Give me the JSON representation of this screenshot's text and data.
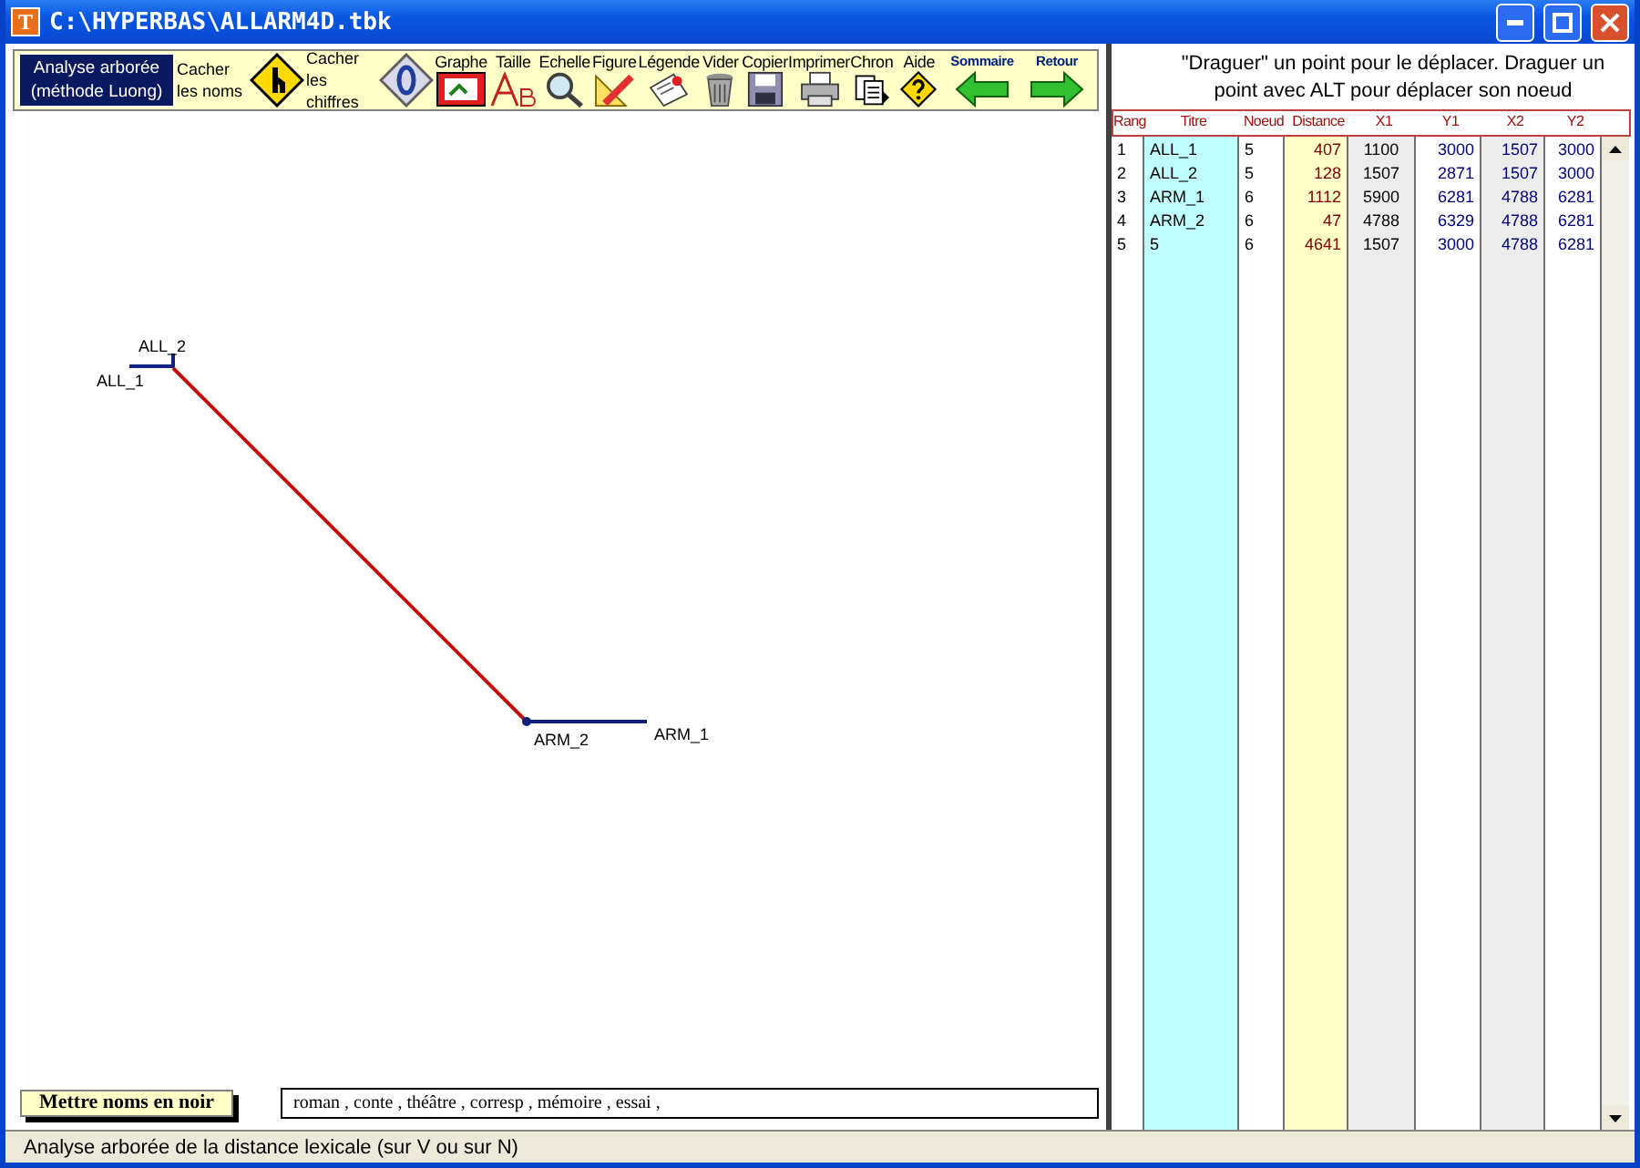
{
  "window": {
    "title": "C:\\HYPERBAS\\ALLARM4D.tbk",
    "app_icon": "T"
  },
  "toolbar": {
    "mode_button": "Analyse arborée (méthode Luong)",
    "items": [
      {
        "label": "Cacher les noms",
        "kind": "side"
      },
      {
        "label": "Cacher les chiffres",
        "kind": "side"
      },
      {
        "label": "Graphe",
        "kind": "top"
      },
      {
        "label": "Taille",
        "kind": "top"
      },
      {
        "label": "Echelle",
        "kind": "top"
      },
      {
        "label": "Figure",
        "kind": "top"
      },
      {
        "label": "Légende",
        "kind": "top"
      },
      {
        "label": "Vider",
        "kind": "top"
      },
      {
        "label": "Copier",
        "kind": "top"
      },
      {
        "label": "Imprimer",
        "kind": "top"
      },
      {
        "label": "Chron",
        "kind": "top"
      },
      {
        "label": "Aide",
        "kind": "top"
      },
      {
        "label": "Sommaire",
        "kind": "nav"
      },
      {
        "label": "Retour",
        "kind": "nav"
      }
    ]
  },
  "diagram": {
    "labels": [
      "ALL_2",
      "ALL_1",
      "ARM_2",
      "ARM_1"
    ]
  },
  "bottom": {
    "button": "Mettre noms en noir",
    "genres": "roman , conte , théâtre , corresp , mémoire , essai ,"
  },
  "hint": "\"Draguer\" un point pour le déplacer. Draguer un point avec ALT pour déplacer son noeud",
  "table": {
    "columns": [
      "Rang",
      "Titre",
      "Noeud",
      "Distance",
      "X1",
      "Y1",
      "X2",
      "Y2"
    ],
    "rows": [
      [
        "1",
        "ALL_1",
        "5",
        "407",
        "1100",
        "3000",
        "1507",
        "3000"
      ],
      [
        "2",
        "ALL_2",
        "5",
        "128",
        "1507",
        "2871",
        "1507",
        "3000"
      ],
      [
        "3",
        "ARM_1",
        "6",
        "1112",
        "5900",
        "6281",
        "4788",
        "6281"
      ],
      [
        "4",
        "ARM_2",
        "6",
        "47",
        "4788",
        "6329",
        "4788",
        "6281"
      ],
      [
        "5",
        "5",
        "6",
        "4641",
        "1507",
        "3000",
        "4788",
        "6281"
      ]
    ]
  },
  "status_bar": "Analyse arborée de la distance lexicale (sur V ou sur N)"
}
